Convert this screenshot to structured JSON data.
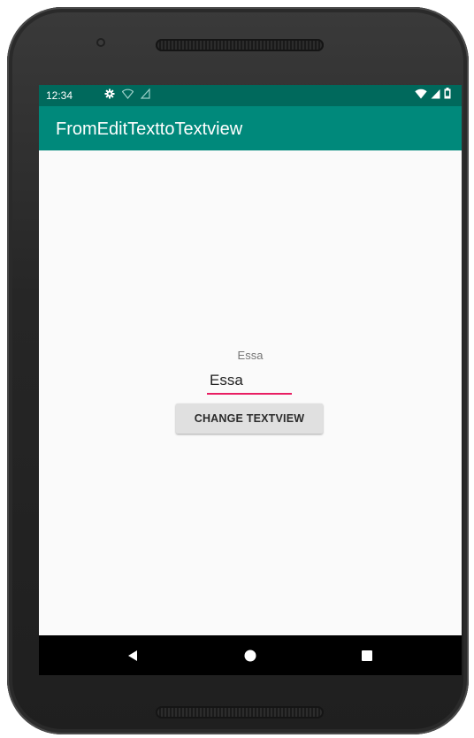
{
  "status_bar": {
    "time": "12:34",
    "color": "#00695c",
    "left_icons": [
      "gear-icon",
      "wifi-question-icon",
      "signal-question-icon"
    ],
    "right_icons": [
      "wifi-icon",
      "cell-signal-icon",
      "battery-icon"
    ]
  },
  "app_bar": {
    "title": "FromEditTexttoTextview",
    "color": "#00897b"
  },
  "main": {
    "text_view": "Essa",
    "edit_text_value": "Essa",
    "edit_text_underline_color": "#e91e63",
    "button_label": "CHANGE TEXTVIEW"
  },
  "nav_bar": {
    "items": [
      "back-icon",
      "home-icon",
      "recents-icon"
    ]
  }
}
